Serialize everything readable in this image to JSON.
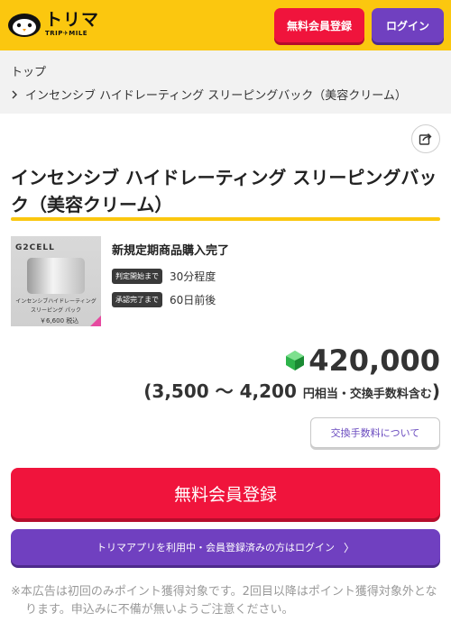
{
  "header": {
    "logo_main": "トリマ",
    "logo_sub": "TRIP✈MILE",
    "register_label": "無料会員登録",
    "login_label": "ログイン"
  },
  "breadcrumb": {
    "home": "トップ",
    "current": "インセンシブ ハイドレーティング スリーピングバック（美容クリーム）"
  },
  "product": {
    "title": "インセンシブ ハイドレーティング スリーピングバック（美容クリーム）",
    "image": {
      "brand": "G2CELL",
      "caption_line1": "インセンシブハイドレーティング",
      "caption_line2": "スリーピング パック",
      "price_text": "￥6,600 税込"
    },
    "condition": "新規定期商品購入完了",
    "judge_label": "判定開始まで",
    "judge_value": "30分程度",
    "approve_label": "承認完了まで",
    "approve_value": "60日前後",
    "points": "420,000",
    "yen_range": "(3,500 〜 4,200",
    "yen_note": "円相当・交換手数料含む",
    "yen_close": ")"
  },
  "buttons": {
    "fee_info": "交換手数料について",
    "register_main": "無料会員登録",
    "login_main": "トリマアプリを利用中・会員登録済みの方はログイン",
    "arrow": "〉"
  },
  "disclaimer": "※本広告は初回のみポイント獲得対象です。2回目以降はポイント獲得対象外となります。申込みに不備が無いようご注意ください。",
  "colors": {
    "brand_yellow": "#fbc70f",
    "register_red": "#f0143c",
    "login_purple": "#7040c0",
    "point_gem_green": "#2db34a"
  }
}
